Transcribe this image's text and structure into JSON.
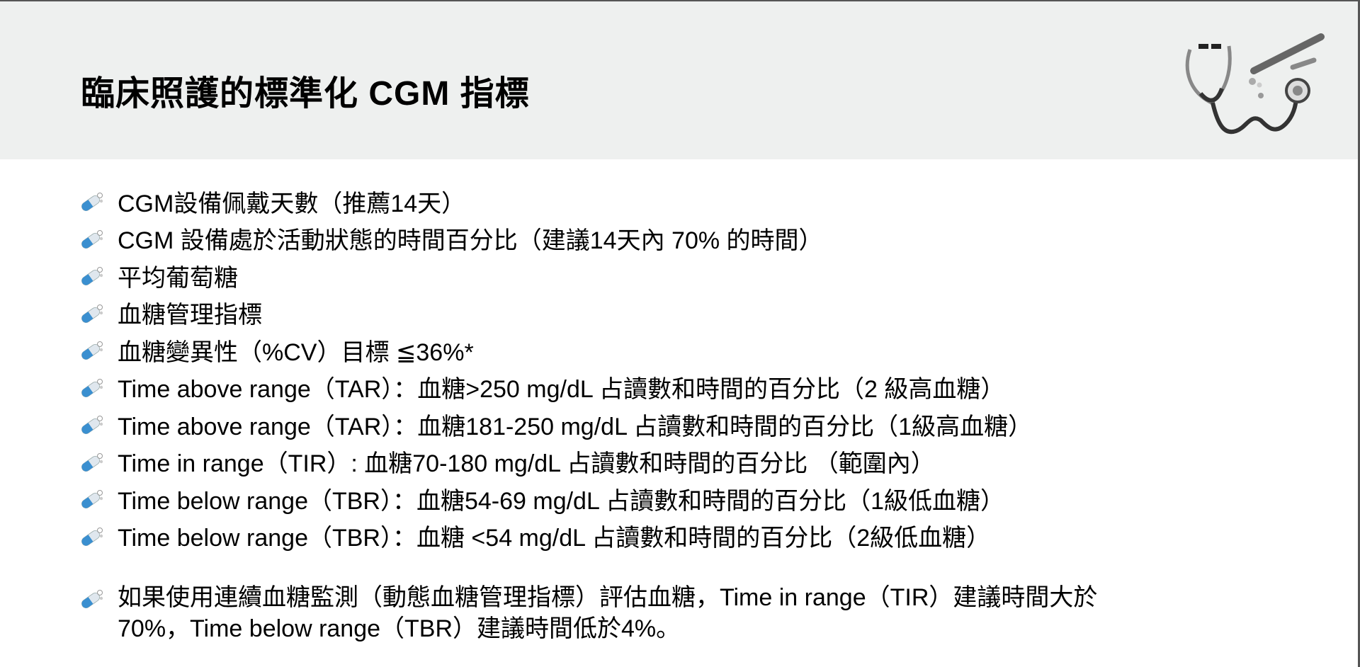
{
  "header": {
    "title": "臨床照護的標準化 CGM 指標"
  },
  "items": [
    {
      "text": "CGM設備佩戴天數（推薦14天）"
    },
    {
      "text": "CGM 設備處於活動狀態的時間百分比（建議14天內 70% 的時間）"
    },
    {
      "text": "平均葡萄糖"
    },
    {
      "text": "血糖管理指標"
    },
    {
      "text": "血糖變異性（%CV）目標 ≦36%*"
    },
    {
      "text": "Time above range（TAR）：血糖>250 mg/dL 占讀數和時間的百分比（2 級高血糖）"
    },
    {
      "text": "Time above range（TAR）：血糖181-250 mg/dL 占讀數和時間的百分比（1級高血糖）"
    },
    {
      "text": "Time in range（TIR）: 血糖70-180 mg/dL 占讀數和時間的百分比 （範圍內）"
    },
    {
      "text": "Time below range（TBR）：血糖54-69 mg/dL 占讀數和時間的百分比（1級低血糖）"
    },
    {
      "text": "Time below range（TBR）：血糖 <54 mg/dL 占讀數和時間的百分比（2級低血糖）"
    }
  ],
  "note": {
    "line1": "如果使用連續血糖監測（動態血糖管理指標）評估血糖，Time in range（TIR）建議時間大於",
    "line2": "70%，Time below range（TBR）建議時間低於4%。"
  },
  "colors": {
    "header_bg": "#eef0ef",
    "pill_blue": "#3a8fd0"
  }
}
